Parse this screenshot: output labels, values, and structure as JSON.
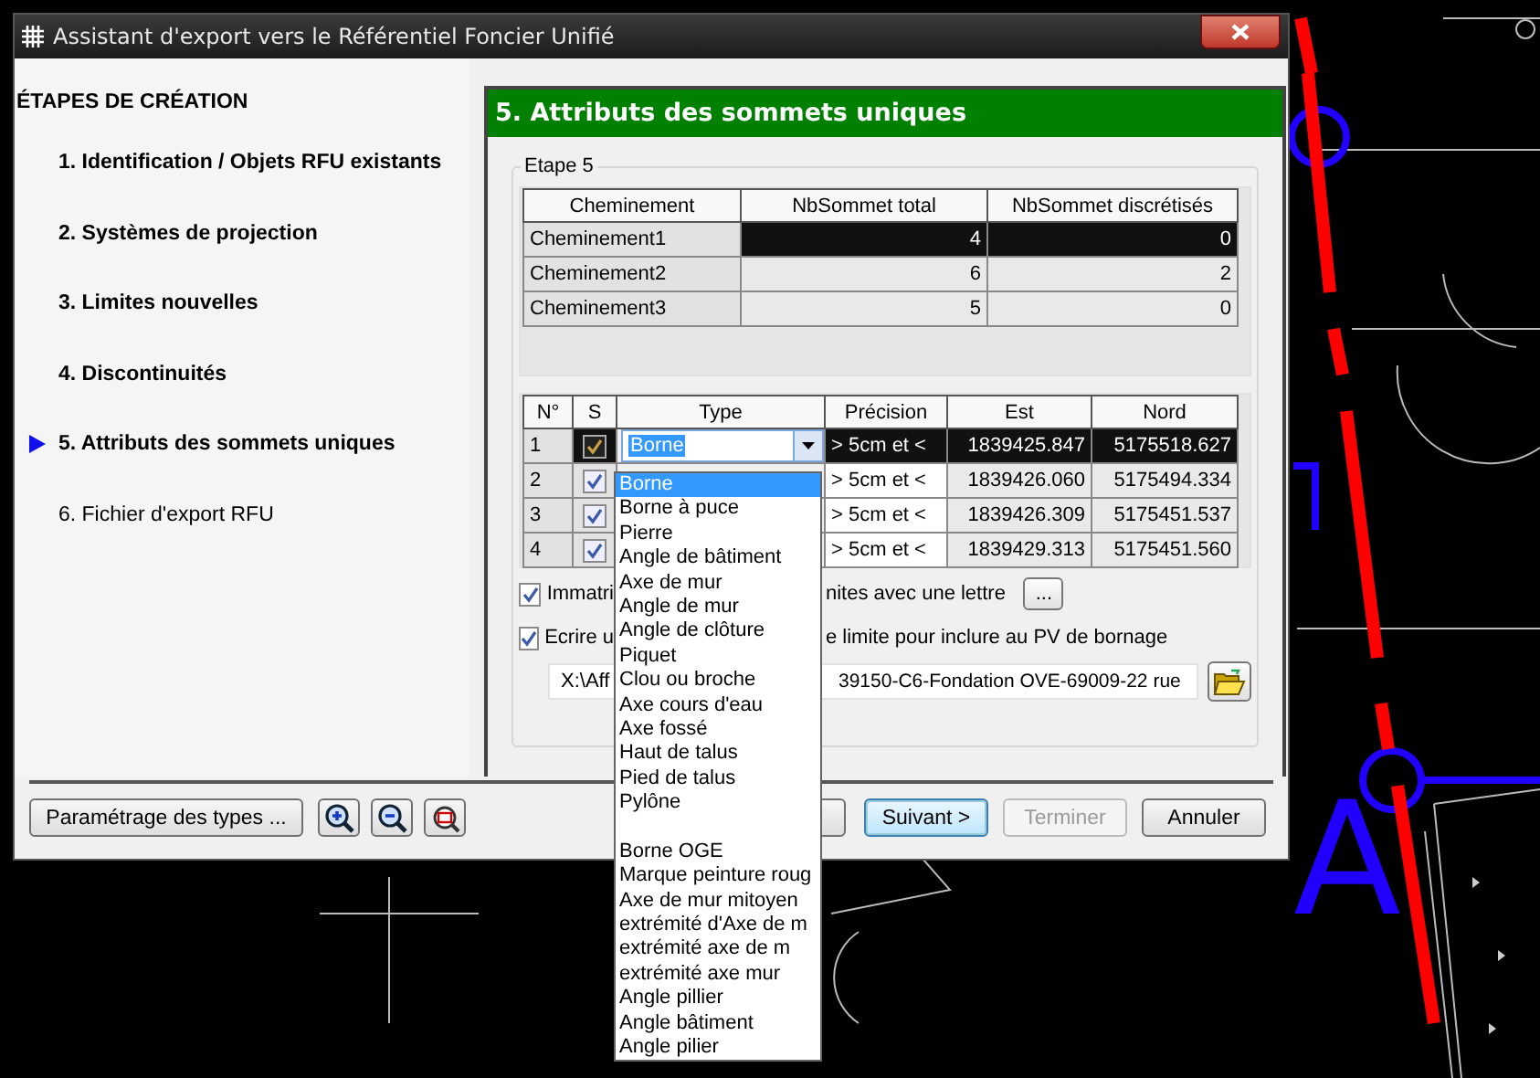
{
  "window": {
    "title": "Assistant d'export vers le Référentiel Foncier Unifié"
  },
  "sidebar": {
    "heading": "ÉTAPES DE CRÉATION",
    "steps": [
      {
        "label": "1. Identification / Objets RFU existants",
        "selected": false,
        "done": true
      },
      {
        "label": "2. Systèmes de projection",
        "selected": false,
        "done": true
      },
      {
        "label": "3. Limites nouvelles",
        "selected": false,
        "done": true
      },
      {
        "label": "4. Discontinuités",
        "selected": false,
        "done": true
      },
      {
        "label": "5. Attributs des sommets uniques",
        "selected": true,
        "done": true
      },
      {
        "label": "6. Fichier d'export RFU",
        "selected": false,
        "done": false
      }
    ]
  },
  "panel": {
    "title": "5. Attributs des sommets uniques",
    "group_label": "Etape 5",
    "paths_table": {
      "columns": [
        "Cheminement",
        "NbSommet total",
        "NbSommet discrétisés"
      ],
      "rows": [
        {
          "cells": [
            "Cheminement1",
            "4",
            "0"
          ],
          "selected": true
        },
        {
          "cells": [
            "Cheminement2",
            "6",
            "2"
          ],
          "selected": false
        },
        {
          "cells": [
            "Cheminement3",
            "5",
            "0"
          ],
          "selected": false
        }
      ]
    },
    "vertices_table": {
      "columns": [
        "N°",
        "S",
        "Type",
        "Précision",
        "Est",
        "Nord"
      ],
      "rows": [
        {
          "number": "1",
          "checked": true,
          "type": "Borne",
          "precision": "> 5cm et <",
          "est": "1839425.847",
          "nord": "5175518.627",
          "selected": true
        },
        {
          "number": "2",
          "checked": true,
          "precision": "> 5cm et <",
          "est": "1839426.060",
          "nord": "5175494.334",
          "selected": false
        },
        {
          "number": "3",
          "checked": true,
          "precision": "> 5cm et <",
          "est": "1839426.309",
          "nord": "5175451.537",
          "selected": false
        },
        {
          "number": "4",
          "checked": true,
          "precision": "> 5cm et <",
          "est": "1839429.313",
          "nord": "5175451.560",
          "selected": false
        }
      ]
    },
    "type_dropdown": {
      "items": [
        {
          "kind": "option",
          "label": "Borne",
          "selected": true
        },
        {
          "kind": "option",
          "label": "Borne à puce",
          "selected": false
        },
        {
          "kind": "option",
          "label": "Pierre",
          "selected": false
        },
        {
          "kind": "option",
          "label": "Angle de bâtiment",
          "selected": false
        },
        {
          "kind": "option",
          "label": "Axe de mur",
          "selected": false
        },
        {
          "kind": "option",
          "label": "Angle de mur",
          "selected": false
        },
        {
          "kind": "option",
          "label": "Angle de clôture",
          "selected": false
        },
        {
          "kind": "option",
          "label": "Piquet",
          "selected": false
        },
        {
          "kind": "option",
          "label": "Clou ou broche",
          "selected": false
        },
        {
          "kind": "option",
          "label": "Axe cours d'eau",
          "selected": false
        },
        {
          "kind": "option",
          "label": "Axe fossé",
          "selected": false
        },
        {
          "kind": "option",
          "label": "Haut de talus",
          "selected": false
        },
        {
          "kind": "option",
          "label": "Pied de talus",
          "selected": false
        },
        {
          "kind": "option",
          "label": "Pylône",
          "selected": false
        },
        {
          "kind": "blank"
        },
        {
          "kind": "option",
          "label": "Borne OGE",
          "selected": false
        },
        {
          "kind": "option",
          "label": "Marque peinture roug",
          "selected": false
        },
        {
          "kind": "option",
          "label": "Axe de mur mitoyen",
          "selected": false
        },
        {
          "kind": "option",
          "label": "extrémité d'Axe de m",
          "selected": false
        },
        {
          "kind": "option",
          "label": "extrémité axe de m",
          "selected": false
        },
        {
          "kind": "option",
          "label": "extrémité axe mur",
          "selected": false
        },
        {
          "kind": "option",
          "label": "Angle pillier",
          "selected": false
        },
        {
          "kind": "option",
          "label": "Angle bâtiment",
          "selected": false
        },
        {
          "kind": "option",
          "label": "Angle pilier",
          "selected": false
        }
      ]
    },
    "options": [
      {
        "label_start": "Immatri",
        "label_end": "nites avec une lettre",
        "checked": true,
        "button": "..."
      },
      {
        "label_start": "Ecrire u",
        "label_end": "e limite pour inclure au PV de bornage",
        "checked": true
      }
    ],
    "path_field": {
      "value_start": "X:\\Aff",
      "value_end": "39150-C6-Fondation OVE-69009-22 rue"
    }
  },
  "footer": {
    "types_button": "Paramétrage des types ...",
    "buttons": [
      {
        "label": "Suivant >",
        "kind": "default",
        "disabled": false
      },
      {
        "label": "Terminer",
        "kind": "normal",
        "disabled": true
      },
      {
        "label": "Annuler",
        "kind": "normal",
        "disabled": false
      }
    ]
  },
  "cad": {
    "label": "A"
  }
}
